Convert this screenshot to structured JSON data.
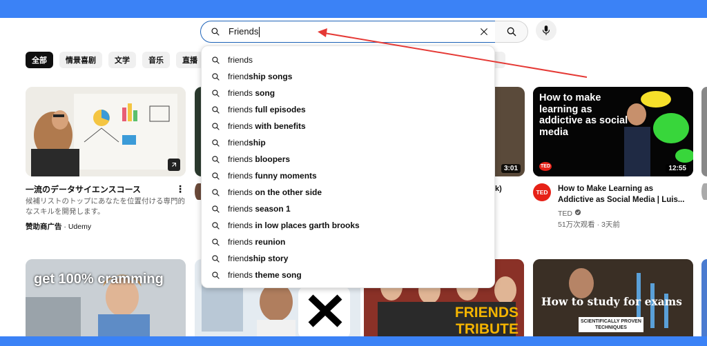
{
  "search": {
    "query": "Friends",
    "icon": "search-icon"
  },
  "chips": [
    "全部",
    "情景喜剧",
    "文学",
    "音乐",
    "直播"
  ],
  "ad": {
    "title": "一流のデータサイエンスコース",
    "description": "候補リストのトップにあなたを位置付ける専門的なスキルを開発します。",
    "sponsored": "赞助商广告",
    "separator": " · ",
    "advertiser": "Udemy"
  },
  "ted_video": {
    "avatar_label": "TED",
    "thumb_text": "How to make learning as addictive as social media",
    "thumb_logo": "TED",
    "duration": "12:55",
    "title": "How to Make Learning as Addictive as Social Media | Luis...",
    "channel": "TED",
    "stats": "51万次观看 · 3天前"
  },
  "partial_video": {
    "duration": "3:01",
    "title_fragment": "k)"
  },
  "bottom_thumbs": {
    "left_text": "get 100% cramming",
    "friends_text_1": "FRIENDS",
    "friends_text_2": "TRIBUTE",
    "study_text": "How to study for exams",
    "study_sub_1": "SCIENTIFICALLY PROVEN",
    "study_sub_2": "TECHNIQUES"
  },
  "suggestions": [
    {
      "base": "friends",
      "rest": ""
    },
    {
      "base": "friend",
      "rest": "ship songs"
    },
    {
      "base": "friends",
      "rest": " song"
    },
    {
      "base": "friends",
      "rest": " full episodes"
    },
    {
      "base": "friends",
      "rest": " with benefits"
    },
    {
      "base": "friend",
      "rest": "ship"
    },
    {
      "base": "friends",
      "rest": " bloopers"
    },
    {
      "base": "friends",
      "rest": " funny moments"
    },
    {
      "base": "friends",
      "rest": " on the other side"
    },
    {
      "base": "friends",
      "rest": " season 1"
    },
    {
      "base": "friends",
      "rest": " in low places garth brooks"
    },
    {
      "base": "friends",
      "rest": " reunion"
    },
    {
      "base": "friend",
      "rest": "ship story"
    },
    {
      "base": "friends",
      "rest": " theme song"
    }
  ],
  "colors": {
    "frame_border": "#3b82f6",
    "annotation_arrow": "#e53935",
    "ted_red": "#e62117",
    "search_focus": "#1c62b9"
  }
}
